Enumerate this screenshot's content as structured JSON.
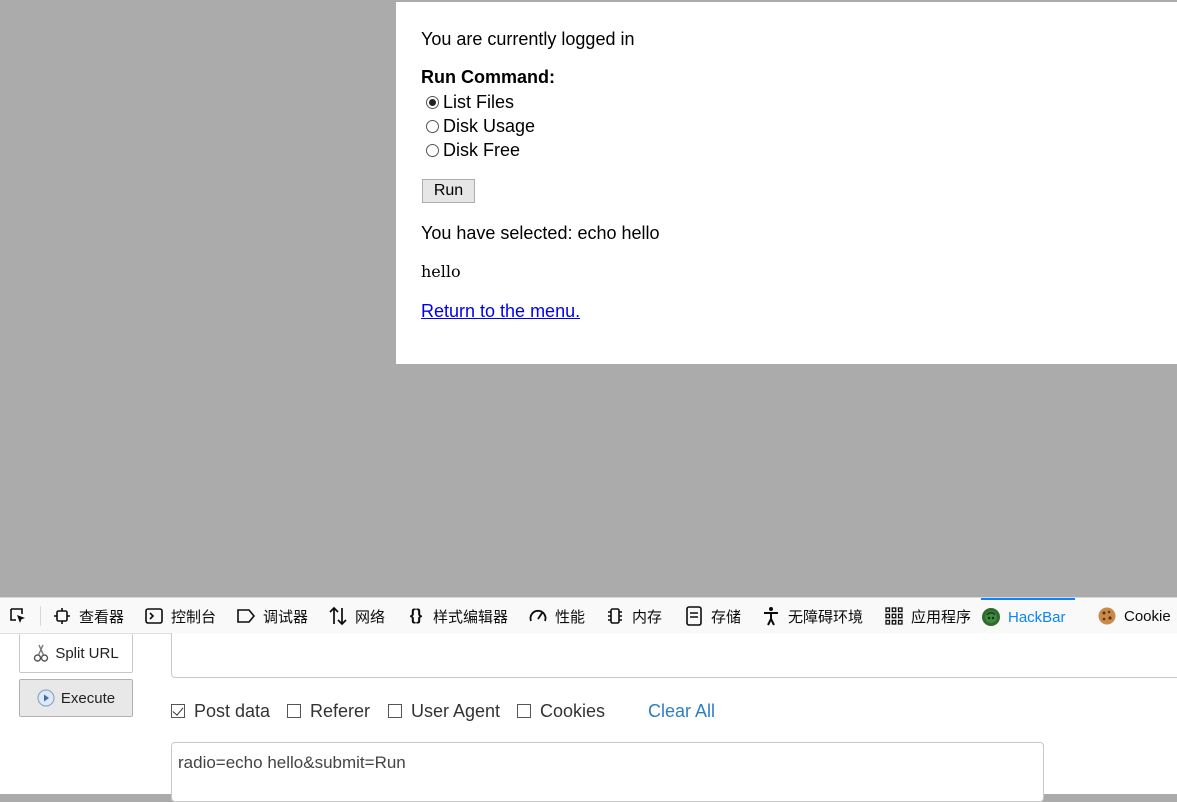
{
  "page": {
    "login_status": "You are currently logged in",
    "command_title": "Run Command:",
    "options": [
      {
        "label": "List Files",
        "checked": true
      },
      {
        "label": "Disk Usage",
        "checked": false
      },
      {
        "label": "Disk Free",
        "checked": false
      }
    ],
    "run_button": "Run",
    "selected_text": "You have selected: echo hello",
    "output": "hello",
    "return_link": "Return to the menu."
  },
  "devtools": {
    "tabs": [
      {
        "label": "查看器",
        "icon": "inspector-icon"
      },
      {
        "label": "控制台",
        "icon": "console-icon"
      },
      {
        "label": "调试器",
        "icon": "debugger-icon"
      },
      {
        "label": "网络",
        "icon": "network-icon"
      },
      {
        "label": "样式编辑器",
        "icon": "style-editor-icon"
      },
      {
        "label": "性能",
        "icon": "performance-icon"
      },
      {
        "label": "内存",
        "icon": "memory-icon"
      },
      {
        "label": "存储",
        "icon": "storage-icon"
      },
      {
        "label": "无障碍环境",
        "icon": "accessibility-icon"
      },
      {
        "label": "应用程序",
        "icon": "application-icon"
      },
      {
        "label": "HackBar",
        "icon": "hackbar-icon",
        "active": true
      },
      {
        "label": "Cookie",
        "icon": "cookie-icon"
      }
    ],
    "active_color": "#0a84ff"
  },
  "hackbar": {
    "split_url_label": "Split URL",
    "execute_label": "Execute",
    "url_value": "",
    "options": [
      {
        "label": "Post data",
        "checked": true
      },
      {
        "label": "Referer",
        "checked": false
      },
      {
        "label": "User Agent",
        "checked": false
      },
      {
        "label": "Cookies",
        "checked": false
      }
    ],
    "clear_all_label": "Clear All",
    "post_data_value": "radio=echo hello&submit=Run"
  }
}
